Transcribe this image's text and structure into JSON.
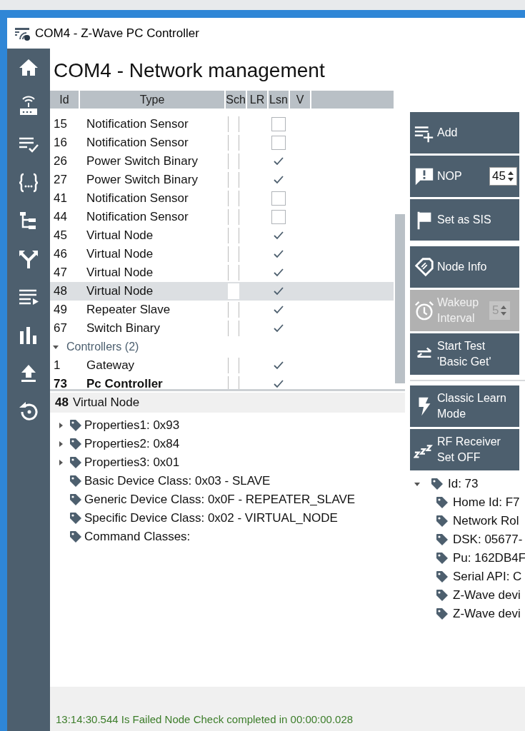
{
  "window": {
    "title": "COM4 - Z-Wave PC Controller"
  },
  "page_title": "COM4  - Network management",
  "table": {
    "columns": [
      "Id",
      "Type",
      "Sch",
      "LR",
      "Lsn",
      "V"
    ],
    "groups": [
      {
        "rows": [
          {
            "id": "15",
            "type": "Notification Sensor",
            "listening": false,
            "selected": false,
            "is_self": false
          },
          {
            "id": "16",
            "type": "Notification Sensor",
            "listening": false,
            "selected": false,
            "is_self": false
          },
          {
            "id": "26",
            "type": "Power Switch Binary",
            "listening": true,
            "selected": false,
            "is_self": false
          },
          {
            "id": "27",
            "type": "Power Switch Binary",
            "listening": true,
            "selected": false,
            "is_self": false
          },
          {
            "id": "41",
            "type": "Notification Sensor",
            "listening": false,
            "selected": false,
            "is_self": false
          },
          {
            "id": "44",
            "type": "Notification Sensor",
            "listening": false,
            "selected": false,
            "is_self": false
          },
          {
            "id": "45",
            "type": "Virtual Node",
            "listening": true,
            "selected": false,
            "is_self": false
          },
          {
            "id": "46",
            "type": "Virtual Node",
            "listening": true,
            "selected": false,
            "is_self": false
          },
          {
            "id": "47",
            "type": "Virtual Node",
            "listening": true,
            "selected": false,
            "is_self": false
          },
          {
            "id": "48",
            "type": "Virtual Node",
            "listening": true,
            "selected": true,
            "is_self": false
          },
          {
            "id": "49",
            "type": "Repeater Slave",
            "listening": true,
            "selected": false,
            "is_self": false
          },
          {
            "id": "67",
            "type": "Switch Binary",
            "listening": true,
            "selected": false,
            "is_self": false
          }
        ]
      },
      {
        "label": "Controllers (2)",
        "expanded": true,
        "rows": [
          {
            "id": "1",
            "type": "Gateway",
            "listening": true,
            "selected": false,
            "is_self": false
          },
          {
            "id": "73",
            "type": "Pc Controller",
            "listening": true,
            "selected": false,
            "is_self": true
          }
        ]
      }
    ]
  },
  "detail": {
    "id": "48",
    "title": "Virtual Node",
    "items": [
      {
        "text": "Properties1: 0x93",
        "expandable": true
      },
      {
        "text": "Properties2: 0x84",
        "expandable": true
      },
      {
        "text": "Properties3: 0x01",
        "expandable": true
      },
      {
        "text": "Basic Device Class: 0x03 - SLAVE",
        "expandable": false
      },
      {
        "text": "Generic Device Class: 0x0F - REPEATER_SLAVE",
        "expandable": false
      },
      {
        "text": "Specific Device Class: 0x02 - VIRTUAL_NODE",
        "expandable": false
      },
      {
        "text": "Command Classes:",
        "expandable": false
      }
    ]
  },
  "action_groups": [
    [
      {
        "label": "Add",
        "disabled": false
      },
      {
        "label": "NOP",
        "disabled": false,
        "spinner": "45"
      },
      {
        "label": "Set as SIS",
        "disabled": false
      }
    ],
    [
      {
        "label": "Node Info",
        "disabled": false
      },
      {
        "label": "Wakeup Interval",
        "disabled": true,
        "spinner": "5"
      },
      {
        "label": "Start Test 'Basic Get'",
        "disabled": false
      }
    ],
    [
      {
        "label": "Classic Learn Mode",
        "disabled": false
      },
      {
        "label": "RF Receiver Set OFF",
        "disabled": false
      }
    ]
  ],
  "controller_tree": {
    "text": "Id: 73",
    "expanded": true,
    "children": [
      {
        "text": "Home Id: F7"
      },
      {
        "text": "Network Rol"
      },
      {
        "text": "DSK: 05677-"
      },
      {
        "text": "Pu: 162DB4F"
      },
      {
        "text": "Serial API: C"
      },
      {
        "text": "Z-Wave devi"
      },
      {
        "text": "Z-Wave devi"
      }
    ]
  },
  "status_bar": "13:14:30.544 Is Failed Node Check completed in 00:00:00.028"
}
